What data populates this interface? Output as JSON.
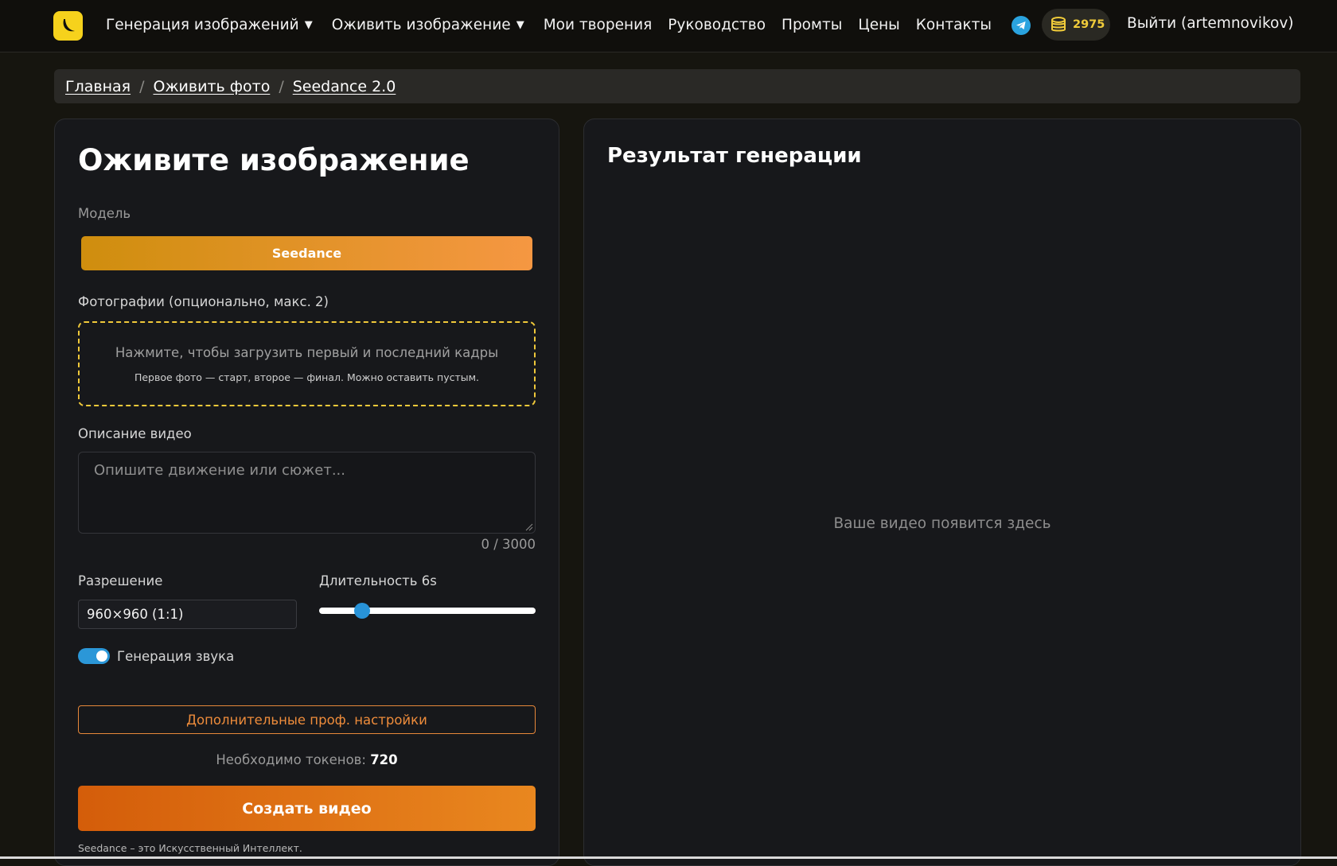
{
  "header": {
    "nav": [
      {
        "label": "Генерация изображений",
        "caret": "▼"
      },
      {
        "label": "Оживить изображение",
        "caret": "▼"
      },
      {
        "label": "Мои творения"
      },
      {
        "label": "Руководство"
      },
      {
        "label": "Промты"
      },
      {
        "label": "Цены"
      },
      {
        "label": "Контакты"
      }
    ],
    "balance": "2975",
    "logout": "Выйти (artemnovikov)"
  },
  "breadcrumb": [
    "Главная",
    "Оживить фото",
    "Seedance 2.0"
  ],
  "form": {
    "title": "Оживите изображение",
    "model_label": "Модель",
    "model_value": "Seedance",
    "photos_label": "Фотографии (опционально, макс. 2)",
    "upload_main": "Нажмите, чтобы загрузить первый и последний кадры",
    "upload_sub": "Первое фото — старт, второе — финал. Можно оставить пустым.",
    "description_label": "Описание видео",
    "description_placeholder": "Опишите движение или сюжет...",
    "char_counter": "0 / 3000",
    "resolution_label": "Разрешение",
    "resolution_value": "960×960 (1:1)",
    "duration_label": "Длительность 6s",
    "duration_fraction": 0.2,
    "sound_label": "Генерация звука",
    "sound_on": true,
    "advanced_button": "Дополнительные проф. настройки",
    "tokens_label": "Необходимо токенов:",
    "tokens_value": "720",
    "create_button": "Создать видео",
    "footnote": "Seedance – это Искусственный Интеллект."
  },
  "result": {
    "title": "Результат генерации",
    "placeholder": "Ваше видео появится здесь"
  },
  "colors": {
    "accent_orange": "#e9871f",
    "accent_yellow": "#f6d21c",
    "accent_blue": "#2893d8"
  }
}
